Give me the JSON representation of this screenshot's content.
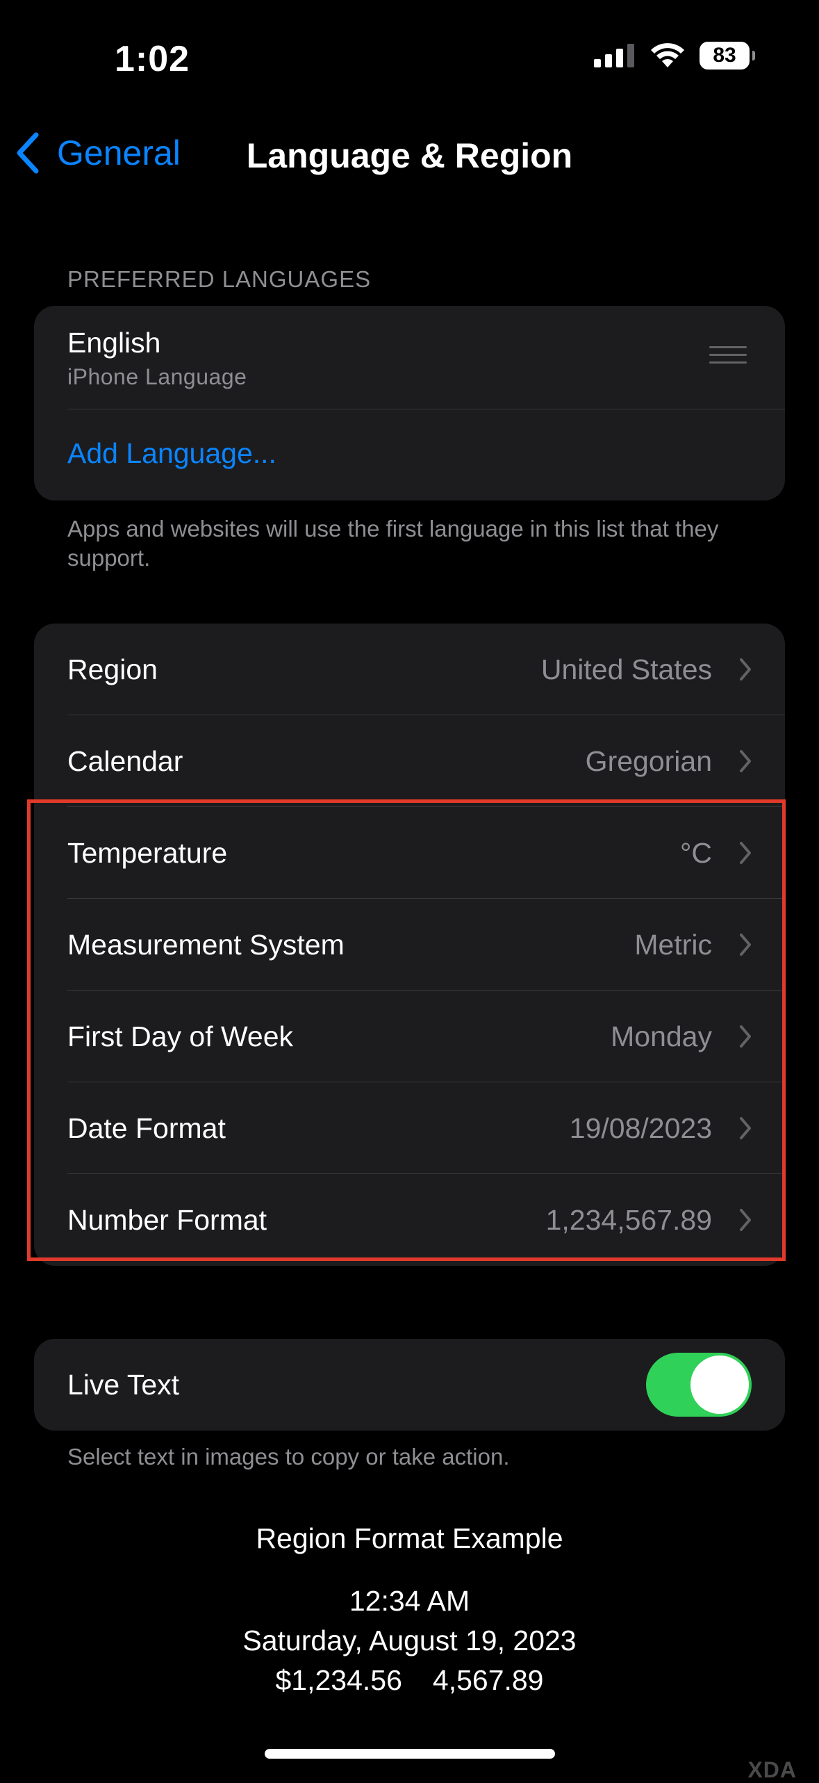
{
  "status_bar": {
    "time": "1:02",
    "battery": "83",
    "icons": [
      "cellular-signal-icon",
      "wifi-icon",
      "battery-icon"
    ]
  },
  "nav": {
    "back_label": "General",
    "title": "Language & Region"
  },
  "preferred_languages": {
    "header": "PREFERRED LANGUAGES",
    "language": "English",
    "language_sub": "iPhone Language",
    "add_label": "Add Language...",
    "footer": "Apps and websites will use the first language in this list that they support."
  },
  "region_settings": [
    {
      "label": "Region",
      "value": "United States"
    },
    {
      "label": "Calendar",
      "value": "Gregorian"
    },
    {
      "label": "Temperature",
      "value": "°C"
    },
    {
      "label": "Measurement System",
      "value": "Metric"
    },
    {
      "label": "First Day of Week",
      "value": "Monday"
    },
    {
      "label": "Date Format",
      "value": "19/08/2023"
    },
    {
      "label": "Number Format",
      "value": "1,234,567.89"
    }
  ],
  "live_text": {
    "label": "Live Text",
    "enabled": true,
    "footer": "Select text in images to copy or take action."
  },
  "format_example": {
    "title": "Region Format Example",
    "time": "12:34 AM",
    "date": "Saturday, August 19, 2023",
    "currency": "$1,234.56",
    "number": "4,567.89"
  },
  "watermark": "XDA",
  "colors": {
    "accent": "#0a84ff",
    "toggle_on": "#30d158",
    "highlight_border": "#e23a2a",
    "group_bg": "#1c1c1e"
  }
}
